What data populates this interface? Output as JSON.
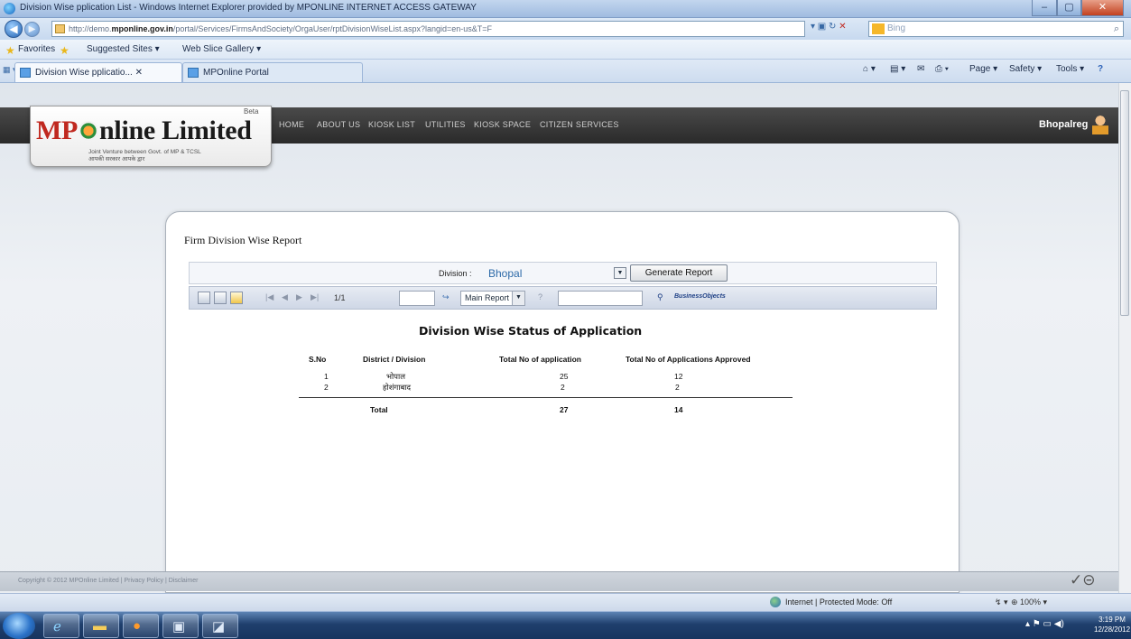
{
  "window": {
    "title": "Division Wise pplication List - Windows Internet Explorer provided by MPONLINE INTERNET ACCESS GATEWAY",
    "min": "–",
    "max": "▢",
    "close": "✕"
  },
  "browser": {
    "url_prefix": "http://demo.",
    "url_domain": "mponline.gov.in",
    "url_rest": "/portal/Services/FirmsAndSociety/OrgaUser/rptDivisionWiseList.aspx?langid=en-us&T=F",
    "search_placeholder": "Bing",
    "favorites_label": "Favorites",
    "fav_suggested": "Suggested Sites ▾",
    "fav_webslice": "Web Slice Gallery ▾",
    "tabs": [
      {
        "label": "Division Wise pplicatio...  ✕"
      },
      {
        "label": "MPOnline Portal"
      }
    ],
    "cmd_page": "Page ▾",
    "cmd_safety": "Safety ▾",
    "cmd_tools": "Tools ▾",
    "cmd_help": "?"
  },
  "site": {
    "logo_mp": "MP",
    "logo_rest": "nline Limited",
    "beta": "Beta",
    "logo_sub_en": "Joint Venture between Govt. of MP & TCSL",
    "logo_sub_hi": "आपकी सरकार आपके द्वार",
    "nav": [
      "HOME",
      "ABOUT US",
      "KIOSK LIST",
      "UTILITIES",
      "KIOSK SPACE",
      "CITIZEN SERVICES"
    ],
    "user": "Bhopalreg"
  },
  "report": {
    "panel_title": "Firm Division Wise Report",
    "division_label": "Division :",
    "division_value": "Bhopal",
    "generate_button": "Generate Report",
    "page_indicator": "1/1",
    "report_select": "Main Report",
    "business_objects": "BusinessObjects",
    "title": "Division Wise Status of Application",
    "columns": [
      "S.No",
      "District / Division",
      "Total No of application",
      "Total No of Applications Approved"
    ],
    "rows": [
      {
        "sno": "1",
        "district": "भोपाल",
        "total": "25",
        "approved": "12"
      },
      {
        "sno": "2",
        "district": "होशंगाबाद",
        "total": "2",
        "approved": "2"
      }
    ],
    "total_label": "Total",
    "total_apps": "27",
    "total_approved": "14"
  },
  "footer": {
    "copyright": "Copyright © 2012 MPOnline Limited | Privacy Policy | Disclaimer"
  },
  "status": {
    "zone": "Internet | Protected Mode: Off",
    "zoom": "⊕ 100% ▾"
  },
  "taskbar": {
    "time": "3:19 PM",
    "date": "12/28/2012"
  }
}
